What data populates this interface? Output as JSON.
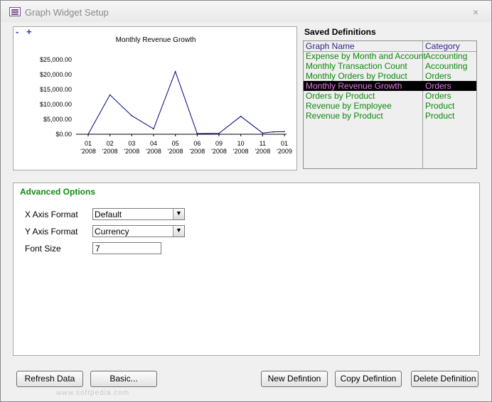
{
  "window": {
    "title": "Graph Widget Setup",
    "close_glyph": "×"
  },
  "chart": {
    "zoom_minus": "-",
    "zoom_plus": "+",
    "chart_data": {
      "type": "line",
      "title": "Monthly Revenue Growth",
      "xlabel": "",
      "ylabel": "",
      "y_ticks": [
        "$25,000.00",
        "$20,000.00",
        "$15,000.00",
        "$10,000.00",
        "$5,000.00",
        "$0.00"
      ],
      "ylim": [
        0,
        25000
      ],
      "categories": [
        [
          "01",
          "'2008"
        ],
        [
          "02",
          "'2008"
        ],
        [
          "03",
          "'2008"
        ],
        [
          "04",
          "'2008"
        ],
        [
          "05",
          "'2008"
        ],
        [
          "06",
          "'2008"
        ],
        [
          "09",
          "'2008"
        ],
        [
          "10",
          "'2008"
        ],
        [
          "11",
          "'2008"
        ],
        [
          "01",
          "'2009"
        ]
      ],
      "x_points": [
        0,
        1,
        2,
        3,
        4,
        5,
        6,
        7,
        8,
        8.5,
        9
      ],
      "values": [
        0,
        13200,
        6200,
        1800,
        21000,
        200,
        300,
        6000,
        400,
        800,
        900
      ],
      "line_color": "#000080",
      "grid": false
    }
  },
  "saved": {
    "title": "Saved Definitions",
    "header": {
      "name": "Graph Name",
      "category": "Category"
    },
    "rows": [
      {
        "name": "Expense by Month and Account",
        "category": "Accounting"
      },
      {
        "name": "Monthly Transaction Count",
        "category": "Accounting"
      },
      {
        "name": "Monthly Orders by Product",
        "category": "Orders"
      },
      {
        "name": "Monthly Revenue Growth",
        "category": "Orders",
        "selected": true
      },
      {
        "name": "Orders by Product",
        "category": "Orders"
      },
      {
        "name": "Revenue by Employee",
        "category": "Product"
      },
      {
        "name": "Revenue by Product",
        "category": "Product"
      }
    ]
  },
  "advanced": {
    "title": "Advanced Options",
    "x_axis_label": "X Axis Format",
    "x_axis_value": "Default",
    "y_axis_label": "Y Axis Format",
    "y_axis_value": "Currency",
    "font_size_label": "Font Size",
    "font_size_value": "7",
    "dropdown_glyph": "▼"
  },
  "buttons": {
    "refresh": "Refresh Data",
    "basic": "Basic...",
    "new": "New Defintion",
    "copy": "Copy Defintion",
    "delete": "Delete Definition"
  },
  "watermark": "www.softpedia.com"
}
